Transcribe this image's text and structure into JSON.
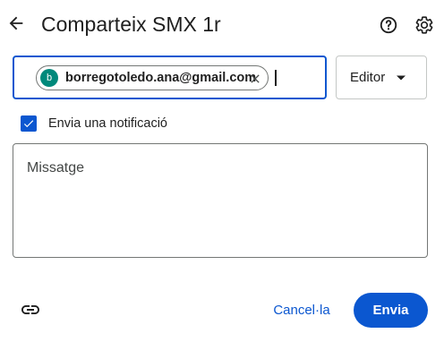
{
  "header": {
    "title": "Comparteix SMX 1r",
    "back_icon": "arrow-back-icon",
    "help_icon": "help-circle-icon",
    "settings_icon": "gear-icon"
  },
  "recipients": {
    "chips": [
      {
        "avatar_letter": "b",
        "email": "borregotoledo.ana@gmail.com",
        "avatar_color": "#00897b"
      }
    ],
    "input_value": ""
  },
  "role": {
    "selected": "Editor"
  },
  "notify": {
    "checked": true,
    "label": "Envia una notificació"
  },
  "message": {
    "placeholder": "Missatge",
    "value": ""
  },
  "footer": {
    "link_icon": "link-icon",
    "cancel_label": "Cancel·la",
    "send_label": "Envia"
  },
  "colors": {
    "accent": "#0b57d0",
    "border": "#747775",
    "text": "#1f1f1f"
  }
}
